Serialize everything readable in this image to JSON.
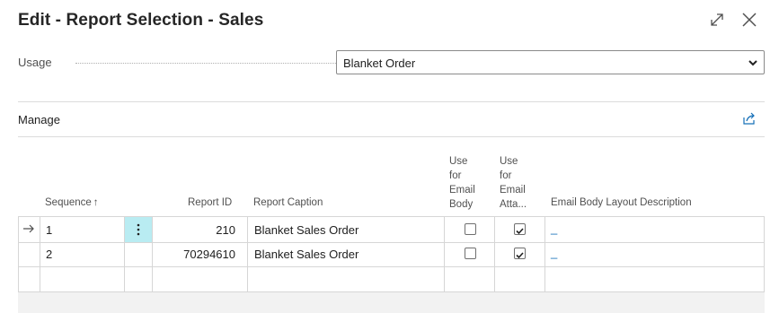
{
  "window": {
    "title": "Edit - Report Selection - Sales"
  },
  "usage": {
    "label": "Usage",
    "selected": "Blanket Order"
  },
  "toolbar": {
    "manage_label": "Manage"
  },
  "table": {
    "headers": {
      "sequence": "Sequence",
      "sort_indicator": "↑",
      "report_id": "Report ID",
      "report_caption": "Report Caption",
      "use_email_body": [
        "Use",
        "for",
        "Email",
        "Body"
      ],
      "use_email_attachment": [
        "Use",
        "for",
        "Email",
        "Atta..."
      ],
      "email_body_layout_description": "Email Body Layout Description"
    },
    "rows": [
      {
        "sequence": "1",
        "report_id": "210",
        "report_caption": "Blanket Sales Order",
        "use_email_body": false,
        "use_email_attachment": true,
        "layout_description": "_",
        "selected": true
      },
      {
        "sequence": "2",
        "report_id": "70294610",
        "report_caption": "Blanket Sales Order",
        "use_email_body": false,
        "use_email_attachment": true,
        "layout_description": "_",
        "selected": false
      }
    ]
  },
  "colors": {
    "accent": "#1670b8",
    "selection": "#b9ecf2",
    "grid_line": "#d6d6d6"
  }
}
